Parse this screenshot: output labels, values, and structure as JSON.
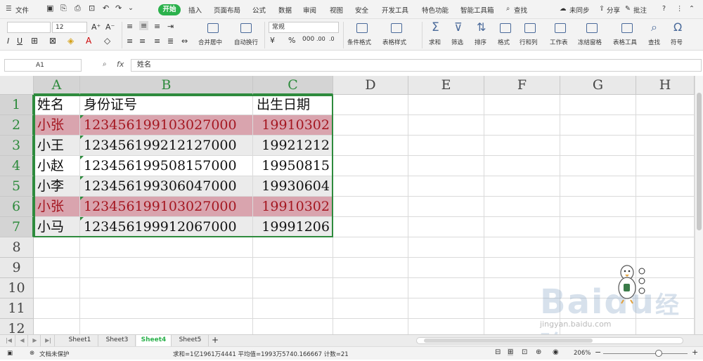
{
  "menu": {
    "file": "文件",
    "start_tab": "开始",
    "tabs": [
      "插入",
      "页面布局",
      "公式",
      "数据",
      "审阅",
      "视图",
      "安全",
      "开发工具",
      "特色功能",
      "智能工具箱"
    ],
    "search": "查找",
    "sync": "未同步",
    "share": "分享",
    "comment": "批注"
  },
  "toolbar": {
    "font_size": "12",
    "merge_center": "合并居中",
    "auto_wrap": "自动换行",
    "number_format": "常规",
    "conditional_format": "条件格式",
    "table_style": "表格样式",
    "sum": "求和",
    "filter": "筛选",
    "sort": "排序",
    "format": "格式",
    "row_col": "行和列",
    "worksheet": "工作表",
    "freeze": "冻结窗格",
    "table_tools": "表格工具",
    "find": "查找",
    "symbol": "符号"
  },
  "formula_bar": {
    "name_box": "A1",
    "fx": "fx",
    "content": "姓名"
  },
  "grid": {
    "col_headers": [
      "A",
      "B",
      "C",
      "D",
      "E",
      "F",
      "G",
      "H"
    ],
    "row_headers": [
      "1",
      "2",
      "3",
      "4",
      "5",
      "6",
      "7",
      "8",
      "9",
      "10",
      "11",
      "12"
    ],
    "header_row": [
      "姓名",
      "身份证号",
      "出生日期"
    ],
    "rows": [
      {
        "name": "小张",
        "id": "123456199103027000",
        "birth": "19910302",
        "duplicate": true
      },
      {
        "name": "小王",
        "id": "123456199212127000",
        "birth": "19921212",
        "duplicate": false
      },
      {
        "name": "小赵",
        "id": "123456199508157000",
        "birth": "19950815",
        "duplicate": false
      },
      {
        "name": "小李",
        "id": "123456199306047000",
        "birth": "19930604",
        "duplicate": false
      },
      {
        "name": "小张",
        "id": "123456199103027000",
        "birth": "19910302",
        "duplicate": true
      },
      {
        "name": "小马",
        "id": "123456199912067000",
        "birth": "19991206",
        "duplicate": false
      }
    ]
  },
  "sheets": {
    "tabs": [
      "Sheet1",
      "Sheet3",
      "Sheet4",
      "Sheet5"
    ],
    "active": "Sheet4",
    "add": "+"
  },
  "status": {
    "doc_protect": "文档未保护",
    "summary": "求和=1亿1961万4441   平均值=1993万5740.166667   计数=21",
    "zoom": "206%"
  },
  "colors": {
    "accent": "#2bb14c",
    "duplicate_fill": "#d9a4ae",
    "duplicate_text": "#a41620",
    "selection_border": "#2e8b3d"
  },
  "watermark": {
    "brand": "Baidu",
    "suffix": "经验",
    "url": "jingyan.baidu.com"
  }
}
